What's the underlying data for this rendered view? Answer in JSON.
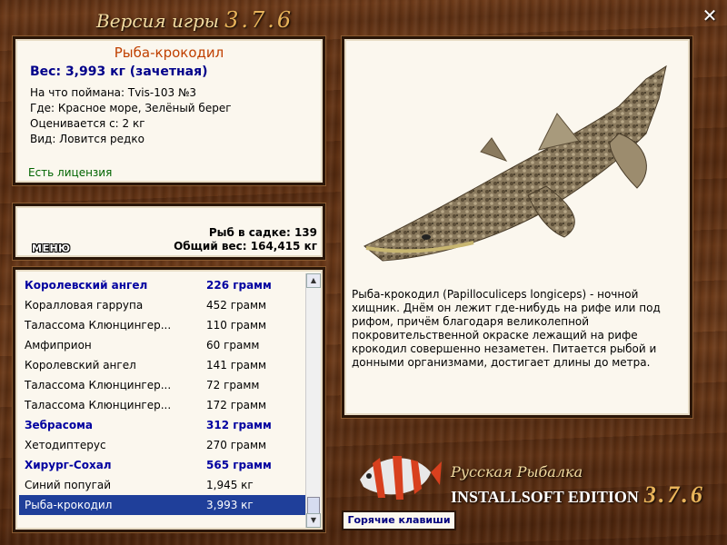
{
  "header": {
    "title": "Версия игры",
    "version": "3.7.6"
  },
  "fish": {
    "name": "Рыба-крокодил",
    "weight": "Вес: 3,993 кг (зачетная)",
    "caught_with": "На что поймана: Tvis-103 №3",
    "where": "Где: Красное море, Зелёный берег",
    "rated_from": "Оценивается с: 2 кг",
    "kind": "Вид: Ловится редко",
    "license": "Есть лицензия",
    "description": "Рыба-крокодил (Papilloculiceps longiceps) - ночной хищник. Днём он лежит где-нибудь на рифе или под рифом, причём благодаря великолепной покровительственной окраске лежащий на рифе крокодил совершенно незаметен. Питается рыбой и донными организмами, достигает длины до метра."
  },
  "stats": {
    "menu_label": "МЕНЮ",
    "fish_in_keepnet": "Рыб в садке: 139",
    "total_weight": "Общий вес: 164,415 кг"
  },
  "catch_list": [
    {
      "name": "Королевский ангел",
      "weight": "226 грамм",
      "bold": true
    },
    {
      "name": "Коралловая гаррупа",
      "weight": "452 грамм",
      "bold": false
    },
    {
      "name": "Талассома Клюнцингер...",
      "weight": "110 грамм",
      "bold": false
    },
    {
      "name": "Амфиприон",
      "weight": "60 грамм",
      "bold": false
    },
    {
      "name": "Королевский ангел",
      "weight": "141 грамм",
      "bold": false
    },
    {
      "name": "Талассома Клюнцингер...",
      "weight": "72 грамм",
      "bold": false
    },
    {
      "name": "Талассома Клюнцингер...",
      "weight": "172 грамм",
      "bold": false
    },
    {
      "name": "Зебрасома",
      "weight": "312 грамм",
      "bold": true
    },
    {
      "name": "Хетодиптерус",
      "weight": "270 грамм",
      "bold": false
    },
    {
      "name": "Хирург-Сохал",
      "weight": "565 грамм",
      "bold": true
    },
    {
      "name": "Синий попугай",
      "weight": "1,945 кг",
      "bold": false
    },
    {
      "name": "Рыба-крокодил",
      "weight": "3,993 кг",
      "bold": false,
      "selected": true
    }
  ],
  "logo": {
    "line1": "Русская Рыбалка",
    "line2": "INSTALLSOFT EDITION",
    "version": "3.7.6"
  },
  "hotkeys_label": "Горячие клавиши",
  "colors": {
    "wood": "#5a2e12",
    "panel": "#fbf7ee",
    "title_orange": "#c04000",
    "weight_blue": "#00008a",
    "license_green": "#006400",
    "selection": "#1f3f9a"
  },
  "icons": {
    "close": "close-icon",
    "fish_picture": "crocodile-fish-image",
    "logo_fish": "clownfish-logo-icon"
  }
}
